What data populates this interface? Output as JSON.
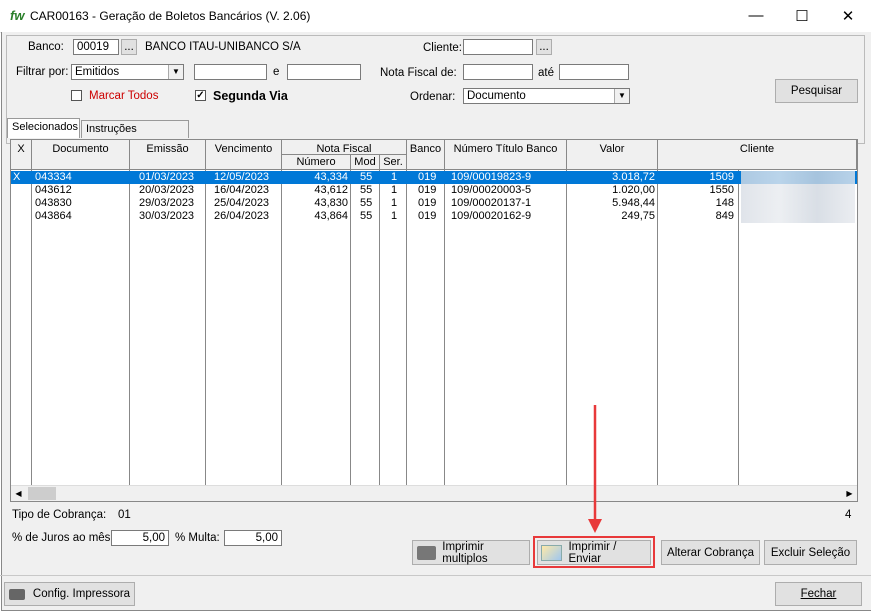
{
  "window": {
    "logo": "fw",
    "title": "CAR00163 - Geração de Boletos Bancários   (V. 2.06)"
  },
  "controls": {
    "minimize": "—",
    "maximize": "☐",
    "close": "✕"
  },
  "filters": {
    "banco_label": "Banco:",
    "banco_code": "00019",
    "browse": "...",
    "banco_name": "BANCO ITAU-UNIBANCO S/A",
    "cliente_label": "Cliente:",
    "cliente_value": "",
    "filtrar_label": "Filtrar por:",
    "filtrar_value": "Emitidos",
    "filtrar_de": "",
    "e_label": "e",
    "filtrar_ate": "",
    "nf_label": "Nota Fiscal de:",
    "nf_de": "",
    "ate_label": "até",
    "nf_ate": "",
    "marcar_todos": "Marcar Todos",
    "segunda_via": "Segunda Via",
    "ordenar_label": "Ordenar:",
    "ordenar_value": "Documento",
    "pesquisar": "Pesquisar"
  },
  "tabs": [
    "Selecionados",
    "Instruções Bancarias"
  ],
  "grid": {
    "headers": {
      "x": "X",
      "documento": "Documento",
      "emissao": "Emissão",
      "vencimento": "Vencimento",
      "nota_fiscal": "Nota Fiscal",
      "numero": "Número",
      "mod": "Mod",
      "ser": "Ser.",
      "banco": "Banco",
      "num_titulo": "Número Título Banco",
      "valor": "Valor",
      "cliente": "Cliente"
    },
    "rows": [
      {
        "x": "X",
        "documento": "043334",
        "emissao": "01/03/2023",
        "vencimento": "12/05/2023",
        "numero": "43,334",
        "mod": "55",
        "ser": "1",
        "banco": "019",
        "titulo": "109/00019823-9",
        "valor": "3.018,72",
        "cliente": "1509"
      },
      {
        "x": "",
        "documento": "043612",
        "emissao": "20/03/2023",
        "vencimento": "16/04/2023",
        "numero": "43,612",
        "mod": "55",
        "ser": "1",
        "banco": "019",
        "titulo": "109/00020003-5",
        "valor": "1.020,00",
        "cliente": "1550"
      },
      {
        "x": "",
        "documento": "043830",
        "emissao": "29/03/2023",
        "vencimento": "25/04/2023",
        "numero": "43,830",
        "mod": "55",
        "ser": "1",
        "banco": "019",
        "titulo": "109/00020137-1",
        "valor": "5.948,44",
        "cliente": "148"
      },
      {
        "x": "",
        "documento": "043864",
        "emissao": "30/03/2023",
        "vencimento": "26/04/2023",
        "numero": "43,864",
        "mod": "55",
        "ser": "1",
        "banco": "019",
        "titulo": "109/00020162-9",
        "valor": "249,75",
        "cliente": "849"
      }
    ]
  },
  "footer": {
    "tipo_label": "Tipo de Cobrança:",
    "tipo_value": "01",
    "count": "4",
    "juros_label": "% de Juros ao mês:",
    "juros_value": "5,00",
    "multa_label": "% Multa:",
    "multa_value": "5,00",
    "imprimir_multiplos": "Imprimir multiplos",
    "imprimir_enviar": "Imprimir / Enviar",
    "alterar_cobranca": "Alterar Cobrança",
    "excluir_selecao": "Excluir Seleção",
    "config_impressora": "Config. Impressora",
    "fechar": "Fechar"
  },
  "colors": {
    "selection": "#0078d7",
    "annotation": "#e8393a",
    "marcar_todos": "#cc0000"
  }
}
